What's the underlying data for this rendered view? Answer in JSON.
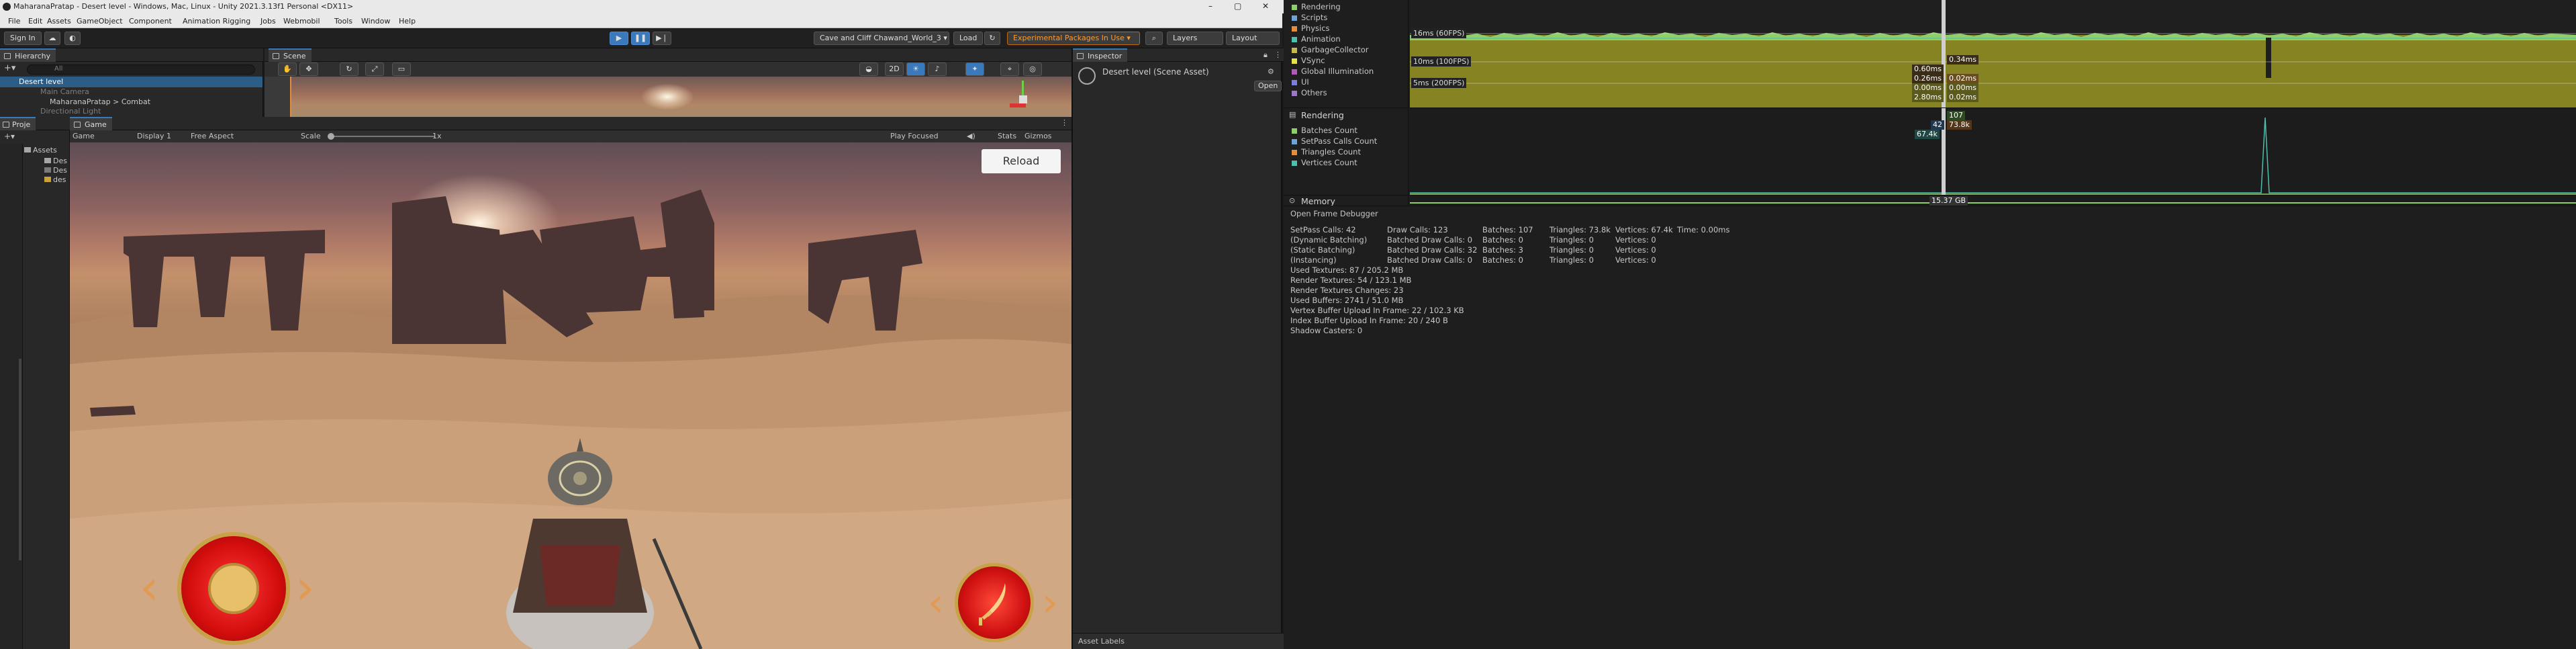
{
  "window": {
    "title": "MaharanaPratap - Desert level - Windows, Mac, Linux - Unity 2021.3.13f1 Personal <DX11>",
    "controls": [
      "–",
      "▢",
      "✕"
    ]
  },
  "menu": [
    "File",
    "Edit",
    "Assets",
    "GameObject",
    "Component",
    "Animation Rigging",
    "Jobs",
    "Webmobil",
    "Tools",
    "Window",
    "Help"
  ],
  "toolbar": {
    "sign_in": "Sign In",
    "scene_dropdown": "Cave and Cliff Chawand_World_3 ▾",
    "load": "Load",
    "experimental": "Experimental Packages In Use ▾",
    "layers": "Layers",
    "layout": "Layout"
  },
  "hierarchy": {
    "tab": "Hierarchy",
    "search_placeholder": "All",
    "items": [
      {
        "label": "Desert level",
        "dim": false
      },
      {
        "label": "Main Camera",
        "dim": true
      },
      {
        "label": "MaharanaPratap > Combat",
        "dim": false
      },
      {
        "label": "Directional Light",
        "dim": true
      }
    ]
  },
  "project": {
    "tabs": [
      "Proje",
      "Game"
    ],
    "folder_root": "Assets",
    "items": [
      "Des",
      "Des",
      "des"
    ]
  },
  "scene_tab": "Scene",
  "game_view": {
    "tab": "Game",
    "display_mode": "Game",
    "display": "Display 1",
    "aspect": "Free Aspect",
    "scale_label": "Scale",
    "scale_value": "1x",
    "play_mode": "Play Focused",
    "stats": "Stats",
    "gizmos": "Gizmos",
    "reload": "Reload"
  },
  "inspector": {
    "tab": "Inspector",
    "asset_name": "Desert level (Scene Asset)",
    "open": "Open",
    "asset_labels": "Asset Labels"
  },
  "profiler": {
    "cpu_legend": [
      {
        "label": "Rendering",
        "color": "#8fcf66"
      },
      {
        "label": "Scripts",
        "color": "#6fa3d8"
      },
      {
        "label": "Physics",
        "color": "#e28d3d"
      },
      {
        "label": "Animation",
        "color": "#4dbfae"
      },
      {
        "label": "GarbageCollector",
        "color": "#c6b84e"
      },
      {
        "label": "VSync",
        "color": "#e6e24a"
      },
      {
        "label": "Global Illumination",
        "color": "#b05ab9"
      },
      {
        "label": "UI",
        "color": "#7c7cda"
      },
      {
        "label": "Others",
        "color": "#9d78c9"
      }
    ],
    "cpu_fps_lines": [
      "16ms (60FPS)",
      "10ms (100FPS)",
      "5ms (200FPS)"
    ],
    "cpu_values_left": [
      "0.60ms",
      "0.26ms",
      "0.00ms",
      "2.80ms"
    ],
    "cpu_values_right": [
      "0.34ms",
      "0.02ms",
      "0.00ms",
      "0.02ms"
    ],
    "rendering_title": "Rendering",
    "rendering_legend": [
      {
        "label": "Batches Count",
        "color": "#8fcf66"
      },
      {
        "label": "SetPass Calls Count",
        "color": "#6fa3d8"
      },
      {
        "label": "Triangles Count",
        "color": "#e28d3d"
      },
      {
        "label": "Vertices Count",
        "color": "#4dbfae"
      }
    ],
    "rendering_tags": [
      "107",
      "42",
      "73.8k",
      "67.4k"
    ],
    "memory_title": "Memory",
    "memory_tag": "15.37 GB",
    "open_frame_debugger": "Open Frame Debugger",
    "stats": [
      [
        "SetPass Calls: 42",
        "Draw Calls: 123",
        "Batches: 107",
        "Triangles: 73.8k",
        "Vertices: 67.4k",
        "Time: 0.00ms"
      ],
      [
        "(Dynamic Batching)",
        "Batched Draw Calls: 0",
        "Batches: 0",
        "Triangles: 0",
        "Vertices: 0",
        ""
      ],
      [
        "(Static Batching)",
        "Batched Draw Calls: 32",
        "Batches: 3",
        "Triangles: 0",
        "Vertices: 0",
        ""
      ],
      [
        "(Instancing)",
        "Batched Draw Calls: 0",
        "Batches: 0",
        "Triangles: 0",
        "Vertices: 0",
        ""
      ]
    ],
    "stats_more": [
      "Used Textures: 87 / 205.2 MB",
      "Render Textures: 54 / 123.1 MB",
      "Render Textures Changes: 23",
      "Used Buffers: 2741 / 51.0 MB",
      "Vertex Buffer Upload In Frame: 22 / 102.3 KB",
      "Index Buffer Upload In Frame: 20 / 240 B",
      "Shadow Casters: 0"
    ]
  }
}
